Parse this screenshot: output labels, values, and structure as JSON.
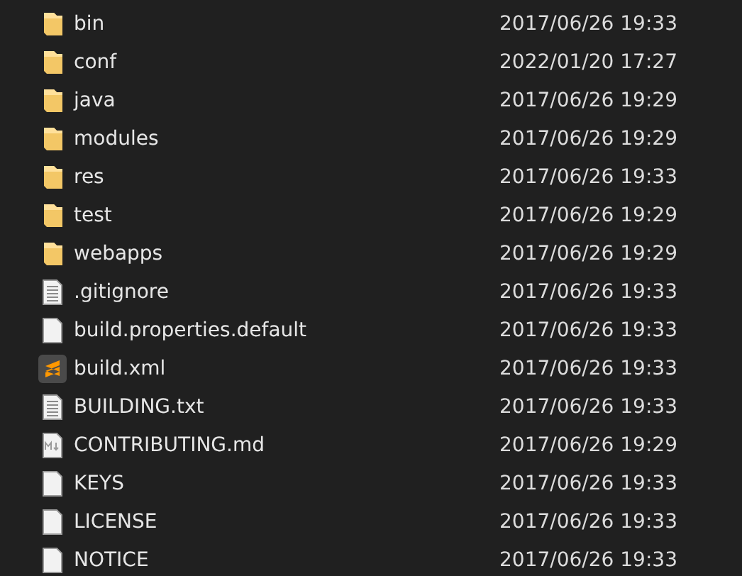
{
  "files": [
    {
      "name": "bin",
      "kind": "folder",
      "modified": "2017/06/26 19:33"
    },
    {
      "name": "conf",
      "kind": "folder",
      "modified": "2022/01/20 17:27"
    },
    {
      "name": "java",
      "kind": "folder",
      "modified": "2017/06/26 19:29"
    },
    {
      "name": "modules",
      "kind": "folder",
      "modified": "2017/06/26 19:29"
    },
    {
      "name": "res",
      "kind": "folder",
      "modified": "2017/06/26 19:33"
    },
    {
      "name": "test",
      "kind": "folder",
      "modified": "2017/06/26 19:29"
    },
    {
      "name": "webapps",
      "kind": "folder",
      "modified": "2017/06/26 19:29"
    },
    {
      "name": ".gitignore",
      "kind": "text",
      "modified": "2017/06/26 19:33"
    },
    {
      "name": "build.properties.default",
      "kind": "blank",
      "modified": "2017/06/26 19:33"
    },
    {
      "name": "build.xml",
      "kind": "sublime",
      "modified": "2017/06/26 19:33"
    },
    {
      "name": "BUILDING.txt",
      "kind": "text",
      "modified": "2017/06/26 19:33"
    },
    {
      "name": "CONTRIBUTING.md",
      "kind": "markdown",
      "modified": "2017/06/26 19:29"
    },
    {
      "name": "KEYS",
      "kind": "blank",
      "modified": "2017/06/26 19:33"
    },
    {
      "name": "LICENSE",
      "kind": "blank",
      "modified": "2017/06/26 19:33"
    },
    {
      "name": "NOTICE",
      "kind": "blank",
      "modified": "2017/06/26 19:33"
    }
  ]
}
